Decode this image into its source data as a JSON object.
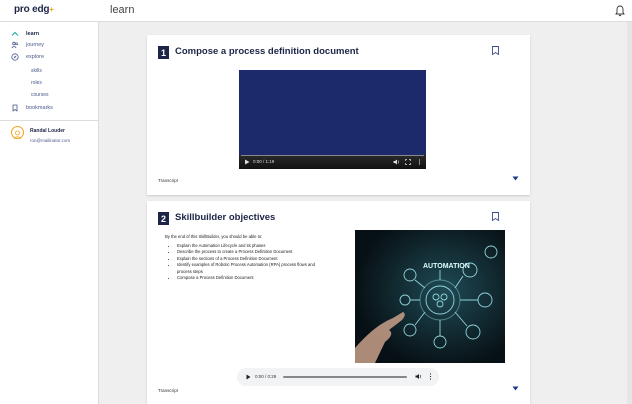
{
  "app": {
    "logo": "pro edg",
    "logo_plus": "+",
    "page_title": "learn"
  },
  "sidebar": {
    "items": [
      {
        "label": "learn",
        "icon": "chevron-up-icon"
      },
      {
        "label": "journey",
        "icon": "users-icon"
      },
      {
        "label": "explore",
        "icon": "compass-icon"
      },
      {
        "label": "bookmarks",
        "icon": "bookmark-icon"
      }
    ],
    "explore_sub": [
      "skills",
      "roles",
      "courses"
    ],
    "user": {
      "name": "Randal Louder",
      "email": "ron@mailinator.com"
    }
  },
  "cards": [
    {
      "number": "1",
      "title": "Compose a process definition document",
      "video": {
        "time": "0:00 / 1:19"
      },
      "transcript": "Transcript"
    },
    {
      "number": "2",
      "title": "Skillbuilder objectives",
      "intro": "By the end of this SkillBuilder, you should be able to:",
      "objectives": [
        "Explain the Automation Lifecycle and its phases",
        "Describe the process to create a Process Definition Document",
        "Explain the sections of a Process Definition Document",
        "Identify examples of Robotic Process Automation (RPA) process flows and process steps",
        "Compose a Process Definition Document"
      ],
      "image_label": "AUTOMATION",
      "audio": {
        "time": "0:00 / 0:29"
      },
      "transcript": "Transcript"
    }
  ],
  "colors": {
    "navy": "#1c2547",
    "accent": "#f2a21b",
    "video_bg": "#1c2a6b"
  }
}
